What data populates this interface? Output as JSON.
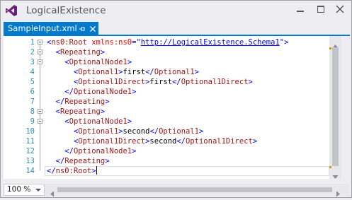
{
  "window": {
    "title": "LogicalExistence",
    "icon": "visual-studio-icon"
  },
  "tab": {
    "label": "SampleInput.xml",
    "pin_icon": "pin-icon",
    "close_icon": "close-icon"
  },
  "editor": {
    "line_numbers": [
      "1",
      "2",
      "3",
      "4",
      "5",
      "6",
      "7",
      "8",
      "9",
      "10",
      "11",
      "12",
      "13",
      "14"
    ],
    "lines": [
      {
        "indent": "",
        "parts": [
          [
            "b",
            "<"
          ],
          [
            "e",
            "ns0:Root"
          ],
          [
            "t",
            " "
          ],
          [
            "a",
            "xmlns:ns0"
          ],
          [
            "b",
            "="
          ],
          [
            "b",
            "\""
          ],
          [
            "v",
            "http://LogicalExistence.Schema1"
          ],
          [
            "b",
            "\""
          ],
          [
            "b",
            ">"
          ]
        ]
      },
      {
        "indent": "  ",
        "parts": [
          [
            "b",
            "<"
          ],
          [
            "e",
            "Repeating"
          ],
          [
            "b",
            ">"
          ]
        ]
      },
      {
        "indent": "    ",
        "parts": [
          [
            "b",
            "<"
          ],
          [
            "e",
            "OptionalNode1"
          ],
          [
            "b",
            ">"
          ]
        ]
      },
      {
        "indent": "      ",
        "parts": [
          [
            "b",
            "<"
          ],
          [
            "e",
            "Optional1"
          ],
          [
            "b",
            ">"
          ],
          [
            "t",
            "first"
          ],
          [
            "b",
            "</"
          ],
          [
            "e",
            "Optional1"
          ],
          [
            "b",
            ">"
          ]
        ]
      },
      {
        "indent": "      ",
        "parts": [
          [
            "b",
            "<"
          ],
          [
            "e",
            "Optional1Direct"
          ],
          [
            "b",
            ">"
          ],
          [
            "t",
            "first"
          ],
          [
            "b",
            "</"
          ],
          [
            "e",
            "Optional1Direct"
          ],
          [
            "b",
            ">"
          ]
        ]
      },
      {
        "indent": "    ",
        "parts": [
          [
            "b",
            "</"
          ],
          [
            "e",
            "OptionalNode1"
          ],
          [
            "b",
            ">"
          ]
        ]
      },
      {
        "indent": "  ",
        "parts": [
          [
            "b",
            "</"
          ],
          [
            "e",
            "Repeating"
          ],
          [
            "b",
            ">"
          ]
        ]
      },
      {
        "indent": "  ",
        "parts": [
          [
            "b",
            "<"
          ],
          [
            "e",
            "Repeating"
          ],
          [
            "b",
            ">"
          ]
        ]
      },
      {
        "indent": "    ",
        "parts": [
          [
            "b",
            "<"
          ],
          [
            "e",
            "OptionalNode1"
          ],
          [
            "b",
            ">"
          ]
        ]
      },
      {
        "indent": "      ",
        "parts": [
          [
            "b",
            "<"
          ],
          [
            "e",
            "Optional1"
          ],
          [
            "b",
            ">"
          ],
          [
            "t",
            "second"
          ],
          [
            "b",
            "</"
          ],
          [
            "e",
            "Optional1"
          ],
          [
            "b",
            ">"
          ]
        ]
      },
      {
        "indent": "      ",
        "parts": [
          [
            "b",
            "<"
          ],
          [
            "e",
            "Optional1Direct"
          ],
          [
            "b",
            ">"
          ],
          [
            "t",
            "second"
          ],
          [
            "b",
            "</"
          ],
          [
            "e",
            "Optional1Direct"
          ],
          [
            "b",
            ">"
          ]
        ]
      },
      {
        "indent": "    ",
        "parts": [
          [
            "b",
            "</"
          ],
          [
            "e",
            "OptionalNode1"
          ],
          [
            "b",
            ">"
          ]
        ]
      },
      {
        "indent": "  ",
        "parts": [
          [
            "b",
            "</"
          ],
          [
            "e",
            "Repeating"
          ],
          [
            "b",
            ">"
          ]
        ]
      },
      {
        "indent": "",
        "parts": [
          [
            "b",
            "</"
          ],
          [
            "e",
            "ns0:Root"
          ],
          [
            "b",
            ">"
          ]
        ]
      }
    ],
    "caret_line": 14
  },
  "statusbar": {
    "zoom": "100 %"
  },
  "colors": {
    "accent": "#007acc",
    "element": "#a31515",
    "bracket": "#0000ff",
    "attribute": "#ff0000",
    "line_number": "#2b91af"
  }
}
